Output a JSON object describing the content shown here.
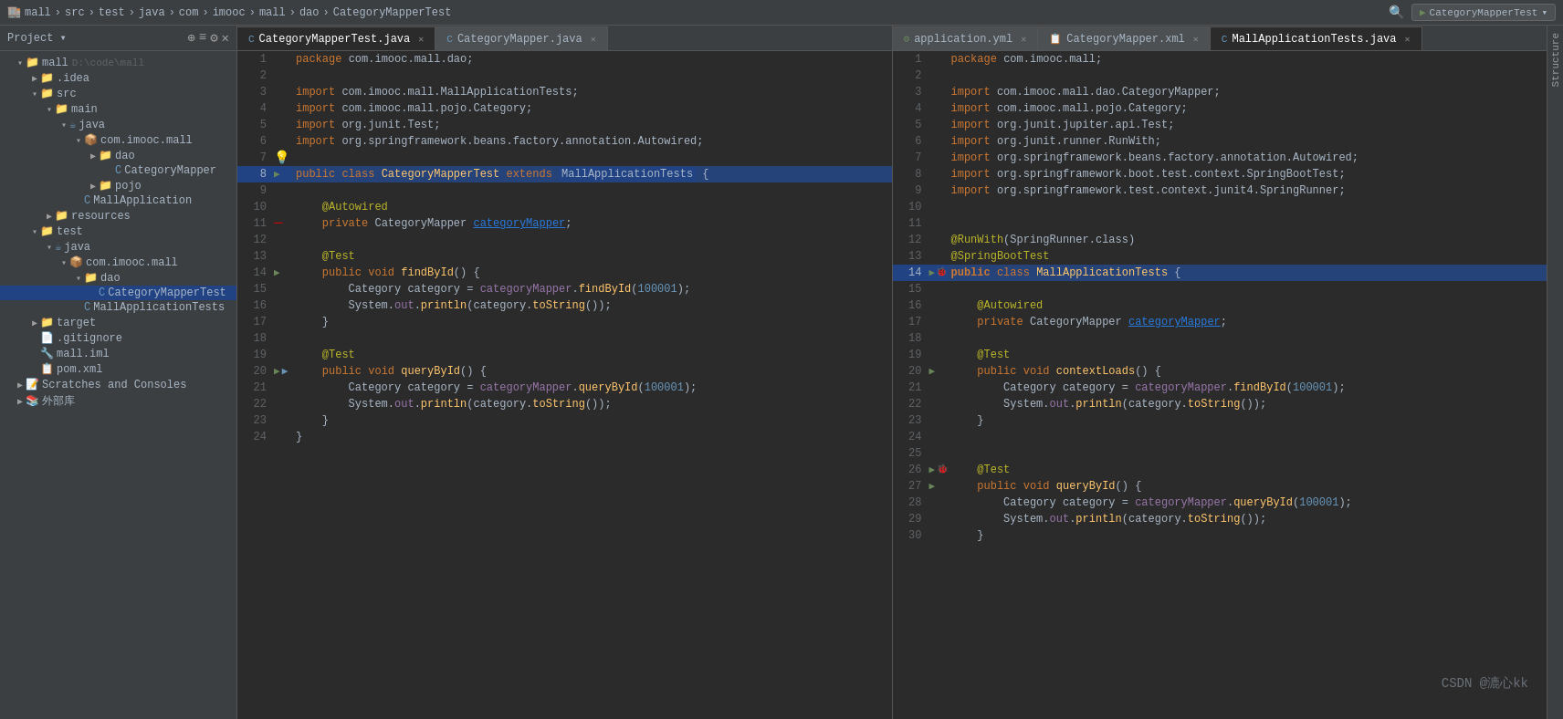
{
  "titlebar": {
    "breadcrumbs": [
      "mall",
      "src",
      "test",
      "java",
      "com",
      "imooc",
      "mall",
      "dao",
      "CategoryMapperTest"
    ],
    "run_config": "CategoryMapperTest",
    "search_icon": "🔍"
  },
  "sidebar": {
    "title": "Project",
    "items": [
      {
        "id": "mall-root",
        "label": "mall D:\\code\\mall",
        "type": "root",
        "indent": 0,
        "expanded": true
      },
      {
        "id": "idea",
        "label": ".idea",
        "type": "folder",
        "indent": 1,
        "expanded": false
      },
      {
        "id": "src",
        "label": "src",
        "type": "folder",
        "indent": 1,
        "expanded": true
      },
      {
        "id": "main",
        "label": "main",
        "type": "folder",
        "indent": 2,
        "expanded": true
      },
      {
        "id": "java-main",
        "label": "java",
        "type": "folder-java",
        "indent": 3,
        "expanded": true
      },
      {
        "id": "com-imooc-mall",
        "label": "com.imooc.mall",
        "type": "package",
        "indent": 4,
        "expanded": true
      },
      {
        "id": "dao",
        "label": "dao",
        "type": "folder",
        "indent": 5,
        "expanded": false
      },
      {
        "id": "CategoryMapper",
        "label": "CategoryMapper",
        "type": "class",
        "indent": 6,
        "expanded": false
      },
      {
        "id": "pojo",
        "label": "pojo",
        "type": "folder",
        "indent": 5,
        "expanded": false
      },
      {
        "id": "MallApplication",
        "label": "MallApplication",
        "type": "class",
        "indent": 5,
        "expanded": false
      },
      {
        "id": "resources",
        "label": "resources",
        "type": "folder",
        "indent": 2,
        "expanded": false
      },
      {
        "id": "test",
        "label": "test",
        "type": "folder",
        "indent": 1,
        "expanded": true
      },
      {
        "id": "java-test",
        "label": "java",
        "type": "folder-java",
        "indent": 2,
        "expanded": true
      },
      {
        "id": "com-imooc-mall-test",
        "label": "com.imooc.mall",
        "type": "package",
        "indent": 3,
        "expanded": true
      },
      {
        "id": "dao-test",
        "label": "dao",
        "type": "folder",
        "indent": 4,
        "expanded": true
      },
      {
        "id": "CategoryMapperTest",
        "label": "CategoryMapperTest",
        "type": "class-active",
        "indent": 5,
        "expanded": false
      },
      {
        "id": "MallApplicationTests",
        "label": "MallApplicationTests",
        "type": "class",
        "indent": 4,
        "expanded": false
      },
      {
        "id": "target",
        "label": "target",
        "type": "folder",
        "indent": 1,
        "expanded": false
      },
      {
        "id": "gitignore",
        "label": ".gitignore",
        "type": "file",
        "indent": 1
      },
      {
        "id": "mall-iml",
        "label": "mall.iml",
        "type": "iml",
        "indent": 1
      },
      {
        "id": "pom-xml",
        "label": "pom.xml",
        "type": "xml",
        "indent": 1
      },
      {
        "id": "scratches",
        "label": "Scratches and Consoles",
        "type": "scratches",
        "indent": 0
      },
      {
        "id": "external",
        "label": "外部库",
        "type": "external",
        "indent": 0
      }
    ]
  },
  "left_editor": {
    "tabs": [
      {
        "label": "CategoryMapperTest.java",
        "active": true,
        "type": "java"
      },
      {
        "label": "CategoryMapper.java",
        "active": false,
        "type": "java"
      }
    ],
    "filename": "CategoryMapperTest.java",
    "lines": [
      {
        "num": 1,
        "content": "package com.imooc.mall.dao;",
        "gutter": ""
      },
      {
        "num": 2,
        "content": "",
        "gutter": ""
      },
      {
        "num": 3,
        "content": "import com.imooc.mall.MallApplicationTests;",
        "gutter": ""
      },
      {
        "num": 4,
        "content": "import com.imooc.mall.pojo.Category;",
        "gutter": ""
      },
      {
        "num": 5,
        "content": "import org.junit.Test;",
        "gutter": ""
      },
      {
        "num": 6,
        "content": "import org.springframework.beans.factory.annotation.Autowired;",
        "gutter": ""
      },
      {
        "num": 7,
        "content": "",
        "gutter": "bulb"
      },
      {
        "num": 8,
        "content": "public class CategoryMapperTest extends MallApplicationTests {",
        "gutter": "run",
        "highlight": true
      },
      {
        "num": 9,
        "content": "",
        "gutter": ""
      },
      {
        "num": 10,
        "content": "    @Autowired",
        "gutter": ""
      },
      {
        "num": 11,
        "content": "    private CategoryMapper categoryMapper;",
        "gutter": "error"
      },
      {
        "num": 12,
        "content": "",
        "gutter": ""
      },
      {
        "num": 13,
        "content": "    @Test",
        "gutter": ""
      },
      {
        "num": 14,
        "content": "    public void findById() {",
        "gutter": "run2"
      },
      {
        "num": 15,
        "content": "        Category category = categoryMapper.findById(100001);",
        "gutter": ""
      },
      {
        "num": 16,
        "content": "        System.out.println(category.toString());",
        "gutter": ""
      },
      {
        "num": 17,
        "content": "    }",
        "gutter": ""
      },
      {
        "num": 18,
        "content": "",
        "gutter": ""
      },
      {
        "num": 19,
        "content": "    @Test",
        "gutter": ""
      },
      {
        "num": 20,
        "content": "    public void queryById() {",
        "gutter": "run2",
        "gutter2": true
      },
      {
        "num": 21,
        "content": "        Category category = categoryMapper.queryById(100001);",
        "gutter": ""
      },
      {
        "num": 22,
        "content": "        System.out.println(category.toString());",
        "gutter": ""
      },
      {
        "num": 23,
        "content": "    }",
        "gutter": ""
      },
      {
        "num": 24,
        "content": "}",
        "gutter": ""
      }
    ]
  },
  "right_editor": {
    "tabs": [
      {
        "label": "application.yml",
        "active": false,
        "type": "yml"
      },
      {
        "label": "CategoryMapper.xml",
        "active": false,
        "type": "xml"
      },
      {
        "label": "MallApplicationTests.java",
        "active": true,
        "type": "java"
      }
    ],
    "filename": "MallApplicationTests.java",
    "lines": [
      {
        "num": 1,
        "content": "package com.imooc.mall;",
        "gutter": ""
      },
      {
        "num": 2,
        "content": "",
        "gutter": ""
      },
      {
        "num": 3,
        "content": "import com.imooc.mall.dao.CategoryMapper;",
        "gutter": ""
      },
      {
        "num": 4,
        "content": "import com.imooc.mall.pojo.Category;",
        "gutter": ""
      },
      {
        "num": 5,
        "content": "import org.junit.jupiter.api.Test;",
        "gutter": ""
      },
      {
        "num": 6,
        "content": "import org.junit.runner.RunWith;",
        "gutter": ""
      },
      {
        "num": 7,
        "content": "import org.springframework.beans.factory.annotation.Autowired;",
        "gutter": ""
      },
      {
        "num": 8,
        "content": "import org.springframework.boot.test.context.SpringBootTest;",
        "gutter": ""
      },
      {
        "num": 9,
        "content": "import org.springframework.test.context.junit4.SpringRunner;",
        "gutter": ""
      },
      {
        "num": 10,
        "content": "",
        "gutter": ""
      },
      {
        "num": 11,
        "content": "",
        "gutter": ""
      },
      {
        "num": 12,
        "content": "@RunWith(SpringRunner.class)",
        "gutter": ""
      },
      {
        "num": 13,
        "content": "@SpringBootTest",
        "gutter": ""
      },
      {
        "num": 14,
        "content": "public class MallApplicationTests {",
        "gutter": "run",
        "highlight": true
      },
      {
        "num": 15,
        "content": "",
        "gutter": ""
      },
      {
        "num": 16,
        "content": "    @Autowired",
        "gutter": ""
      },
      {
        "num": 17,
        "content": "    private CategoryMapper categoryMapper;",
        "gutter": ""
      },
      {
        "num": 18,
        "content": "",
        "gutter": ""
      },
      {
        "num": 19,
        "content": "    @Test",
        "gutter": ""
      },
      {
        "num": 20,
        "content": "    public void contextLoads() {",
        "gutter": "run2"
      },
      {
        "num": 21,
        "content": "        Category category = categoryMapper.findById(100001);",
        "gutter": ""
      },
      {
        "num": 22,
        "content": "        System.out.println(category.toString());",
        "gutter": ""
      },
      {
        "num": 23,
        "content": "    }",
        "gutter": ""
      },
      {
        "num": 24,
        "content": "",
        "gutter": ""
      },
      {
        "num": 25,
        "content": "",
        "gutter": ""
      },
      {
        "num": 26,
        "content": "    @Test",
        "gutter": ""
      },
      {
        "num": 27,
        "content": "    public void queryById() {",
        "gutter": "run2"
      },
      {
        "num": 28,
        "content": "        Category category = categoryMapper.queryById(100001);",
        "gutter": ""
      },
      {
        "num": 29,
        "content": "        System.out.println(category.toString());",
        "gutter": ""
      },
      {
        "num": 30,
        "content": "    }",
        "gutter": ""
      }
    ]
  },
  "watermark": "CSDN @漉心kk",
  "bottom_bar": {
    "structure_label": "Structure"
  }
}
